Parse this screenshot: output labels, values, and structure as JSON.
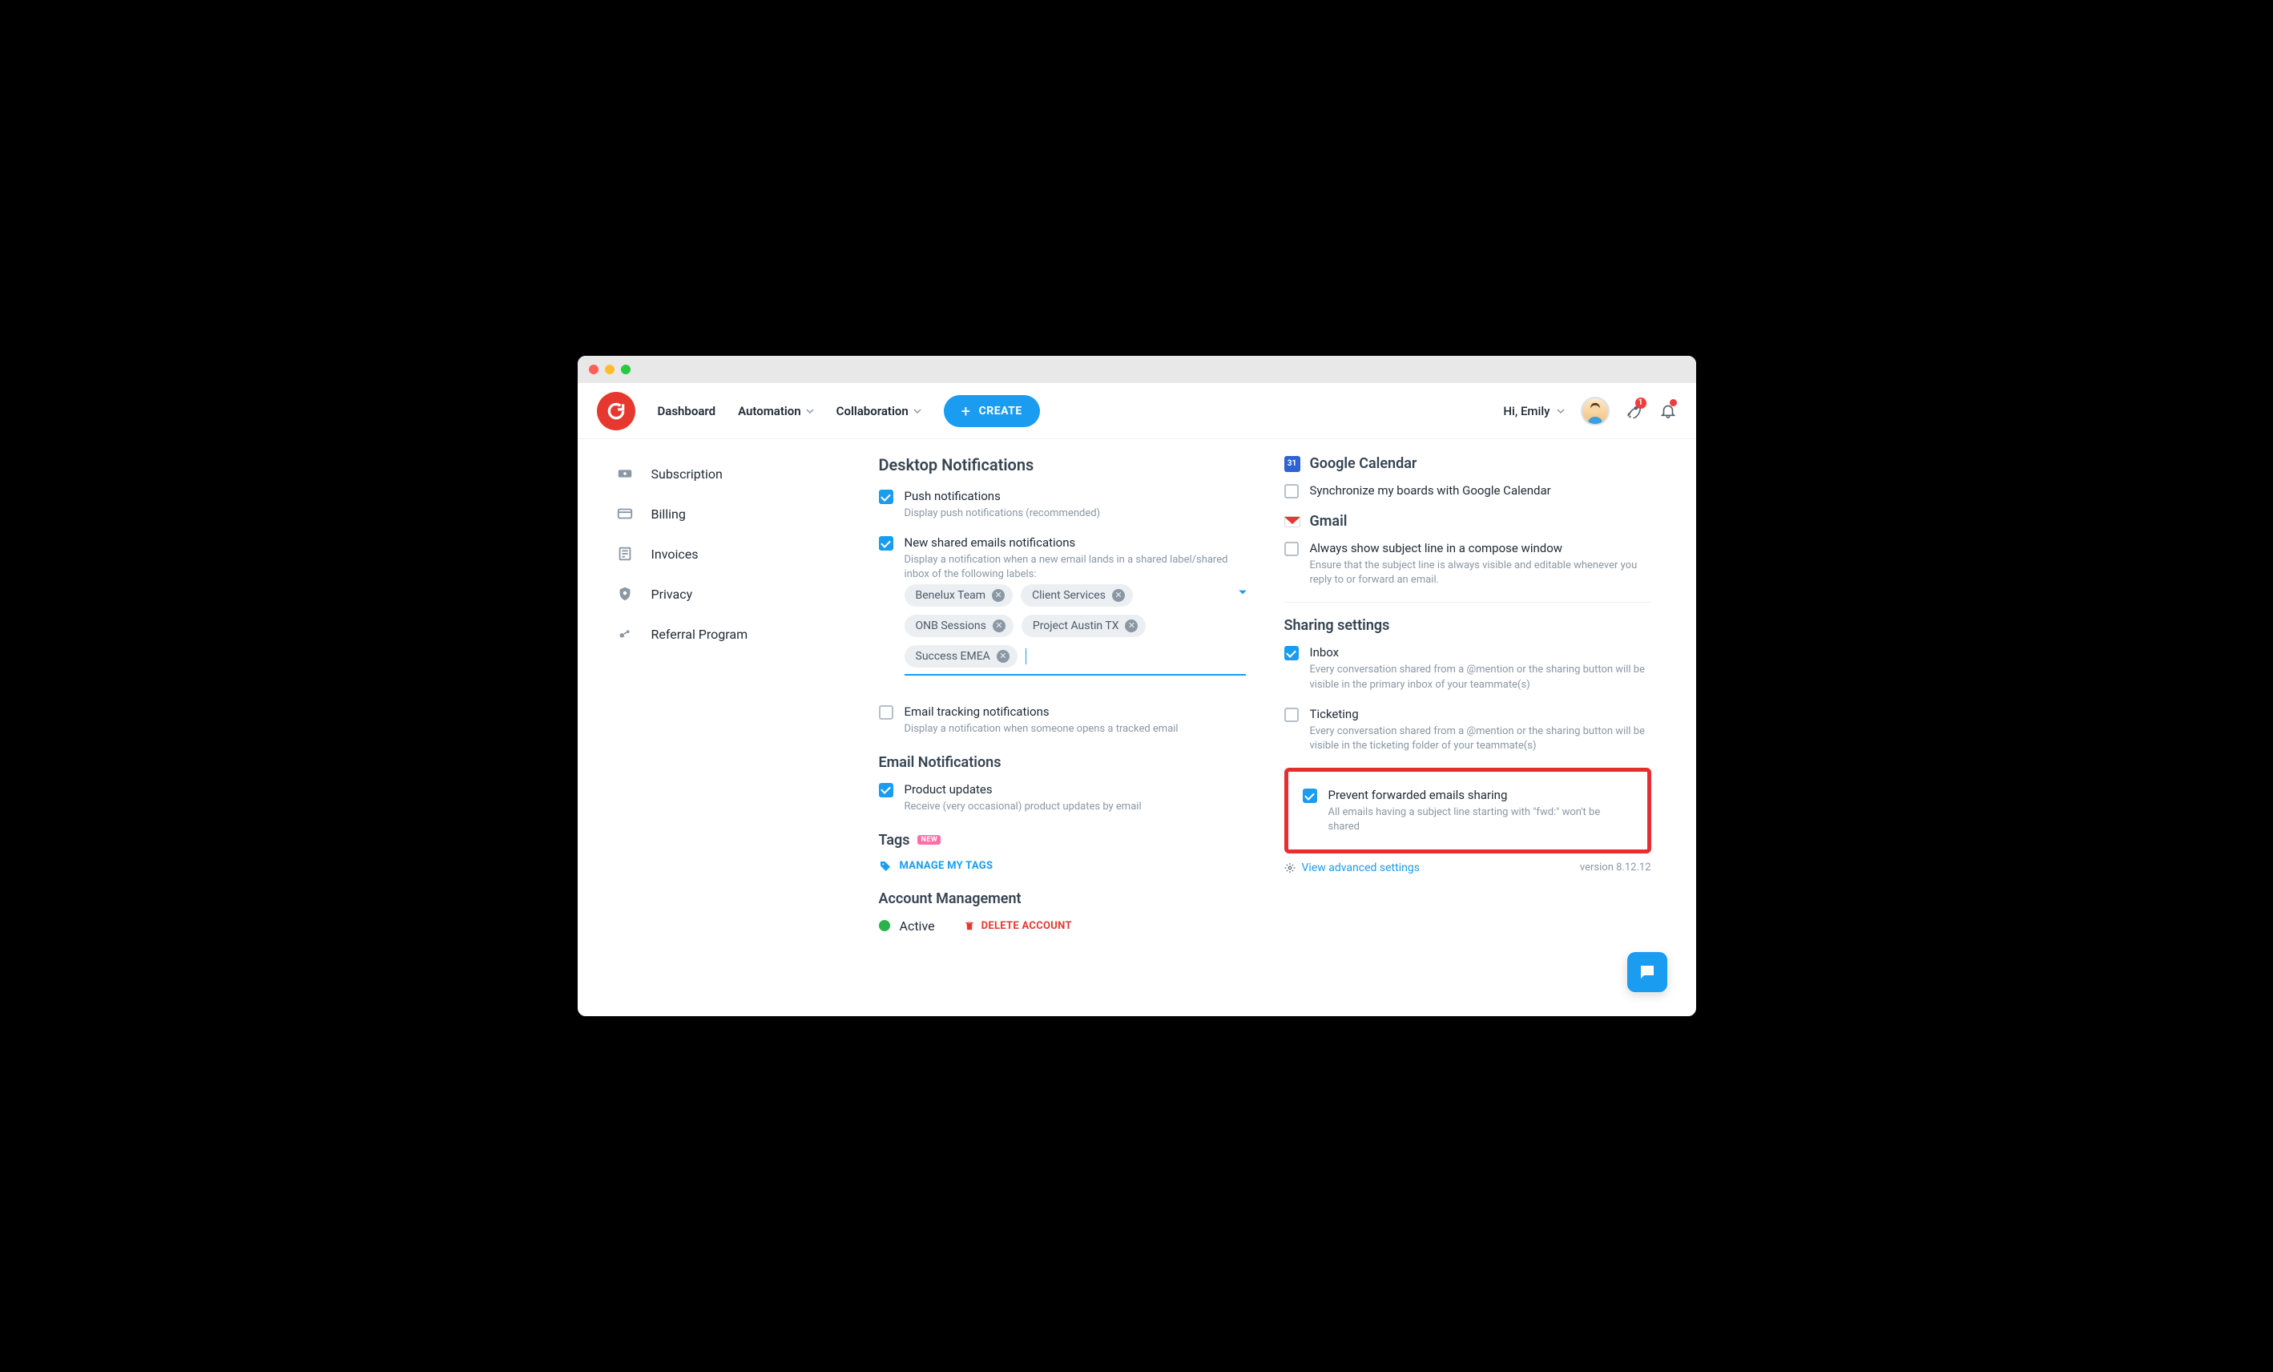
{
  "topbar": {
    "nav": {
      "dashboard": "Dashboard",
      "automation": "Automation",
      "collaboration": "Collaboration"
    },
    "create": "CREATE",
    "greeting": "Hi, Emily",
    "rocket_badge": "1"
  },
  "sidebar": {
    "items": [
      {
        "label": "Subscription"
      },
      {
        "label": "Billing"
      },
      {
        "label": "Invoices"
      },
      {
        "label": "Privacy"
      },
      {
        "label": "Referral Program"
      }
    ]
  },
  "left": {
    "desktop_title": "Desktop Notifications",
    "push": {
      "label": "Push notifications",
      "hint": "Display push notifications (recommended)"
    },
    "shared_emails": {
      "label": "New shared emails notifications",
      "hint": "Display a notification when a new email lands in a shared label/shared inbox of the following labels:",
      "chips": [
        "Benelux Team",
        "Client Services",
        "ONB Sessions",
        "Project Austin TX",
        "Success EMEA"
      ]
    },
    "tracking": {
      "label": "Email tracking notifications",
      "hint": "Display a notification when someone opens a tracked email"
    },
    "email_title": "Email Notifications",
    "product_updates": {
      "label": "Product updates",
      "hint": "Receive (very occasional) product updates by email"
    },
    "tags_title": "Tags",
    "tags_badge": "NEW",
    "manage_tags": "MANAGE MY TAGS",
    "account_title": "Account Management",
    "status": "Active",
    "delete": "DELETE ACCOUNT"
  },
  "right": {
    "gcal_title": "Google Calendar",
    "gcal_day": "31",
    "gcal_sync": {
      "label": "Synchronize my boards with Google Calendar"
    },
    "gmail_title": "Gmail",
    "gmail_subject": {
      "label": "Always show subject line in a compose window",
      "hint": "Ensure that the subject line is always visible and editable whenever you reply to or forward an email."
    },
    "sharing_title": "Sharing settings",
    "inbox": {
      "label": "Inbox",
      "hint": "Every conversation shared from a @mention or the sharing button will be visible in the primary inbox of your teammate(s)"
    },
    "ticketing": {
      "label": "Ticketing",
      "hint": "Every conversation shared from a @mention or the sharing button will be visible in the ticketing folder of your teammate(s)"
    },
    "prevent_fwd": {
      "label": "Prevent forwarded emails sharing",
      "hint": "All emails having a subject line starting with \"fwd:\" won't be shared"
    },
    "advanced": "View advanced settings",
    "version": "version 8.12.12"
  }
}
